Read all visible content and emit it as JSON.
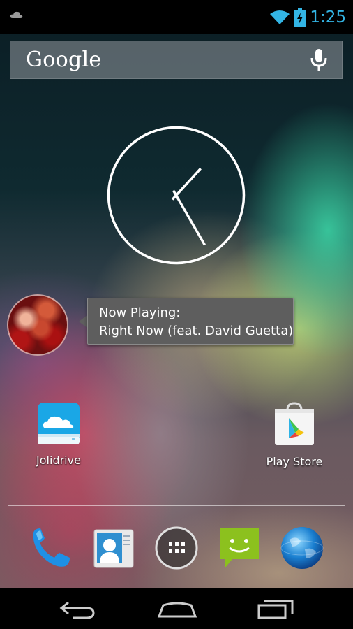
{
  "status_bar": {
    "time": "1:25",
    "icons": [
      "cloud-icon",
      "wifi-icon",
      "battery-charging-icon"
    ],
    "accent_color": "#33b5e5"
  },
  "search": {
    "label": "Google",
    "icon": "microphone-icon"
  },
  "clock": {
    "hour": 1,
    "minute": 25
  },
  "music": {
    "line1": "Now Playing:",
    "line2": "Right Now (feat. David Guetta)"
  },
  "apps": [
    {
      "label": "Jolidrive",
      "icon": "jolidrive-cloud-icon"
    },
    {
      "label": "Play Store",
      "icon": "play-store-icon"
    }
  ],
  "dock": [
    {
      "icon": "phone-icon"
    },
    {
      "icon": "contacts-icon"
    },
    {
      "icon": "app-drawer-icon"
    },
    {
      "icon": "messaging-icon"
    },
    {
      "icon": "browser-globe-icon"
    }
  ],
  "nav": [
    {
      "icon": "back-icon"
    },
    {
      "icon": "home-icon"
    },
    {
      "icon": "recent-apps-icon"
    }
  ]
}
